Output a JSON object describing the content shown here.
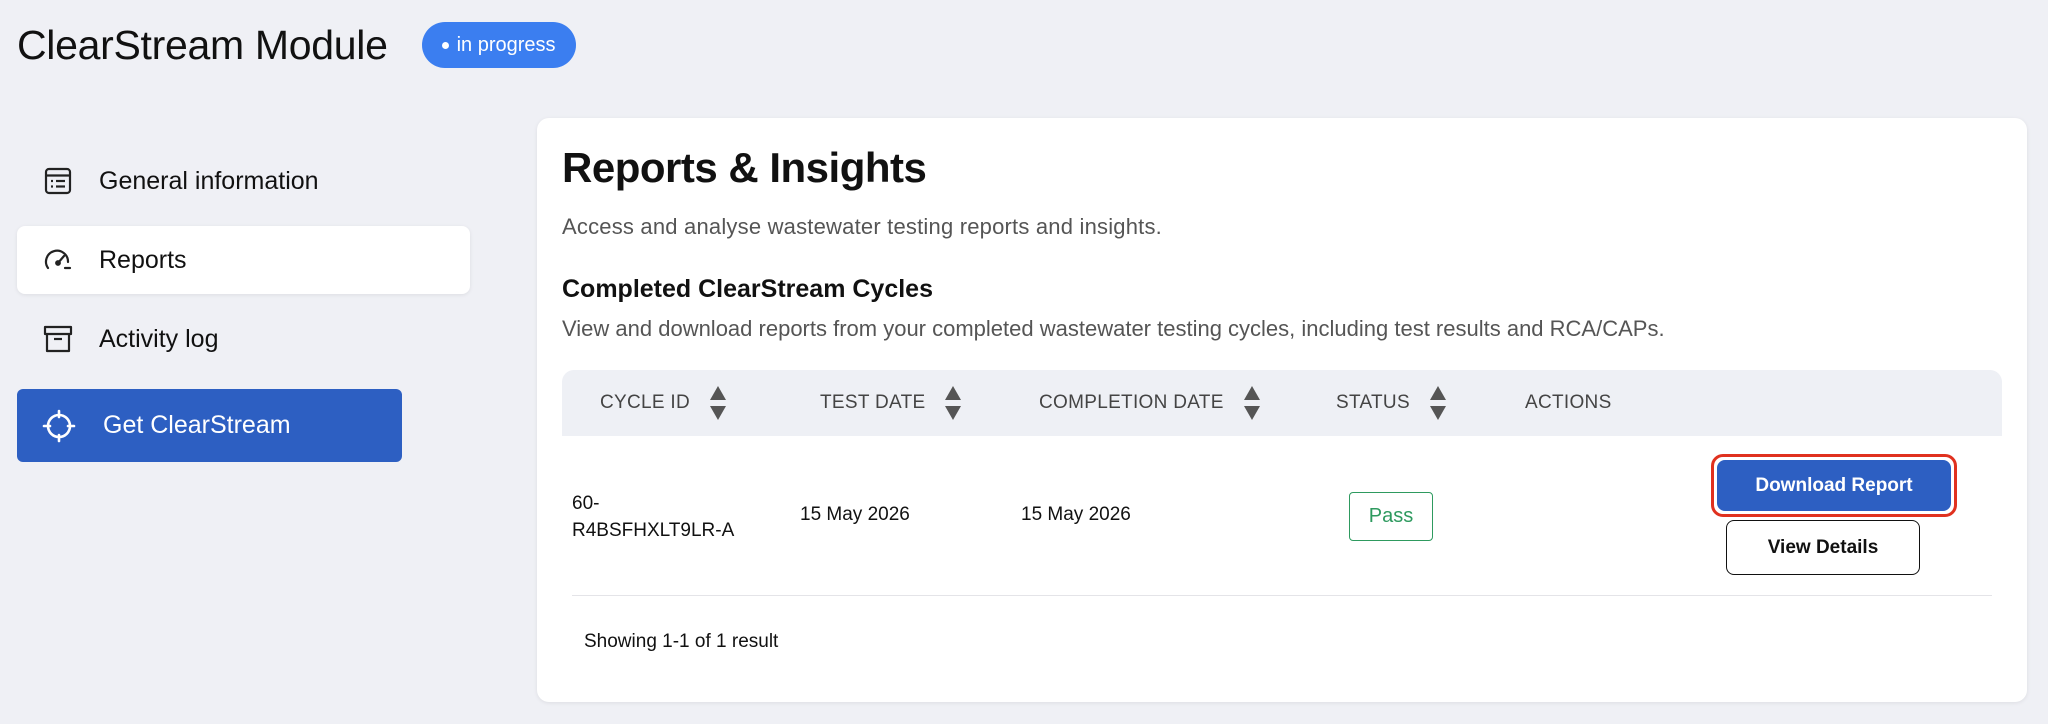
{
  "header": {
    "title": "ClearStream Module",
    "status": "in progress"
  },
  "sidebar": {
    "items": [
      {
        "label": "General information",
        "icon": "list-icon",
        "active": false
      },
      {
        "label": "Reports",
        "icon": "gauge-icon",
        "active": true
      },
      {
        "label": "Activity log",
        "icon": "archive-icon",
        "active": false
      }
    ],
    "cta": {
      "label": "Get ClearStream",
      "icon": "crosshair-icon"
    }
  },
  "main": {
    "title": "Reports & Insights",
    "subtitle": "Access and analyse wastewater testing reports and insights.",
    "section": {
      "title": "Completed ClearStream Cycles",
      "description": "View and download reports from your completed wastewater testing cycles, including test results and RCA/CAPs."
    },
    "table": {
      "columns": [
        "CYCLE ID",
        "TEST DATE",
        "COMPLETION DATE",
        "STATUS",
        "ACTIONS"
      ],
      "rows": [
        {
          "cycle_id": "60-R4BSFHXLT9LR-A",
          "test_date": "15 May 2026",
          "completion_date": "15 May 2026",
          "status": "Pass",
          "actions": {
            "download": "Download Report",
            "view": "View Details"
          }
        }
      ]
    },
    "pagination": "Showing 1-1 of 1 result"
  },
  "colors": {
    "accent": "#2d5fc2",
    "status_pill": "#3b7ef0",
    "pass": "#2e9a5f",
    "highlight": "#e0311f",
    "background": "#eff0f5"
  }
}
